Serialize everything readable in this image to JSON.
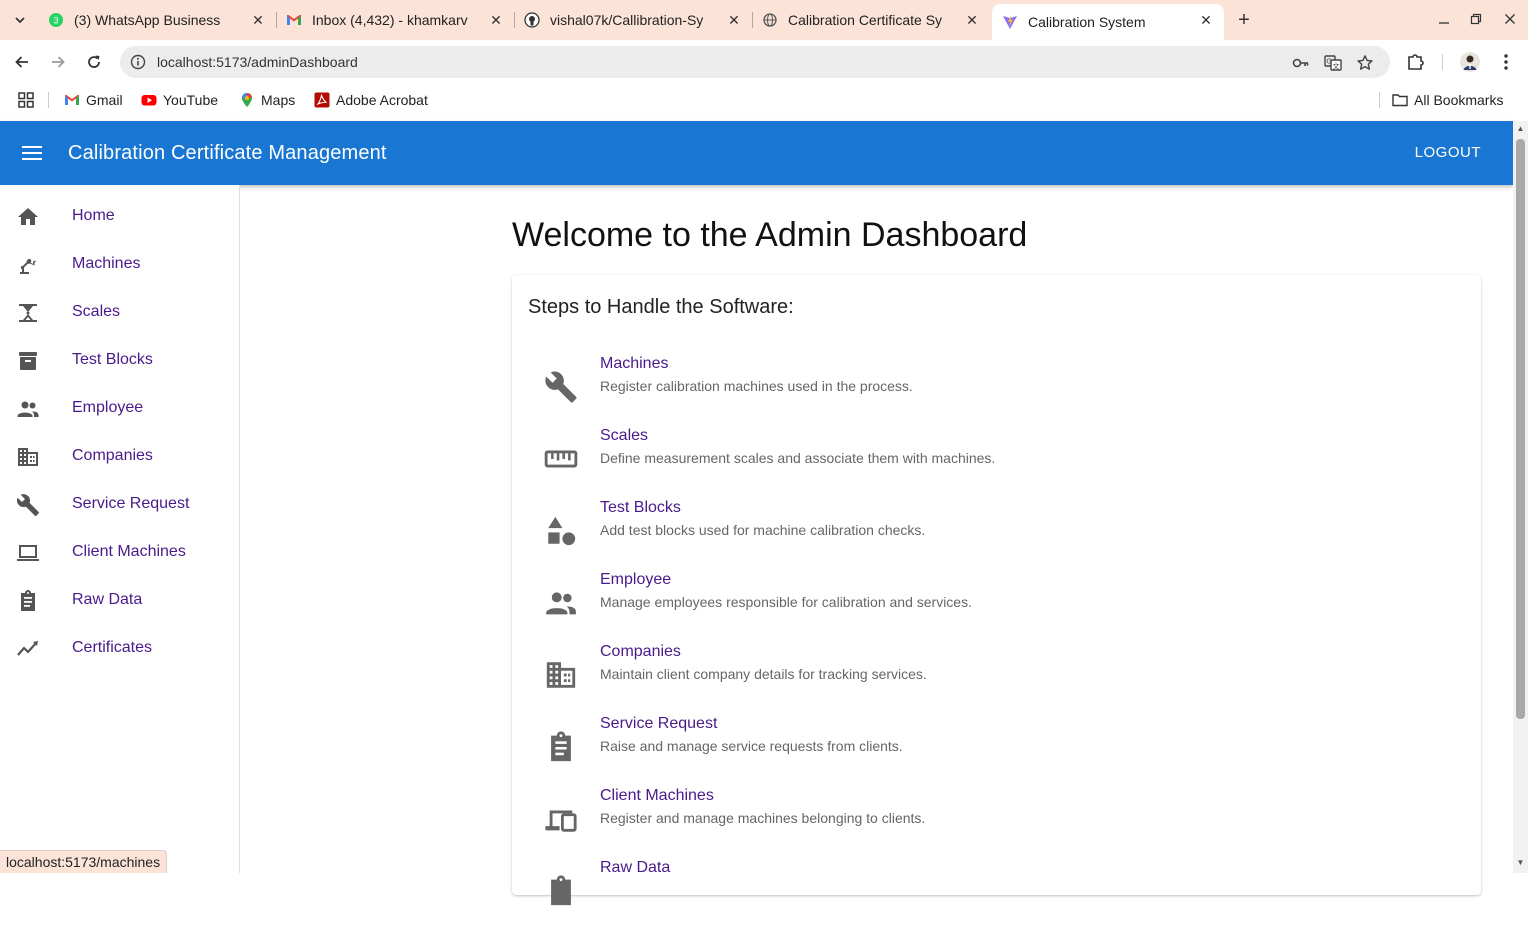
{
  "browser": {
    "tabs": [
      {
        "title": "(3) WhatsApp Business",
        "icon": "whatsapp-icon",
        "active": false
      },
      {
        "title": "Inbox (4,432) - khamkarv",
        "icon": "gmail-icon",
        "active": false
      },
      {
        "title": "vishal07k/Callibration-Sy",
        "icon": "github-icon",
        "active": false
      },
      {
        "title": "Calibration Certificate Sy",
        "icon": "globe-icon",
        "active": false
      },
      {
        "title": "Calibration System",
        "icon": "vite-icon",
        "active": true
      }
    ],
    "url": "localhost:5173/adminDashboard",
    "bookmarks": [
      "Gmail",
      "YouTube",
      "Maps",
      "Adobe Acrobat"
    ],
    "all_bookmarks": "All Bookmarks",
    "status_url": "localhost:5173/machines"
  },
  "header": {
    "title": "Calibration Certificate Management",
    "logout": "LOGOUT",
    "color": "#1976d2"
  },
  "sidebar": {
    "items": [
      {
        "label": "Home",
        "icon": "home-icon"
      },
      {
        "label": "Machines",
        "icon": "precision-manufacturing-icon"
      },
      {
        "label": "Scales",
        "icon": "scale-icon"
      },
      {
        "label": "Test Blocks",
        "icon": "archive-box-icon"
      },
      {
        "label": "Employee",
        "icon": "people-icon"
      },
      {
        "label": "Companies",
        "icon": "building-icon"
      },
      {
        "label": "Service Request",
        "icon": "wrench-icon"
      },
      {
        "label": "Client Machines",
        "icon": "laptop-icon"
      },
      {
        "label": "Raw Data",
        "icon": "clipboard-icon"
      },
      {
        "label": "Certificates",
        "icon": "trend-line-icon"
      }
    ]
  },
  "main": {
    "title": "Welcome to the Admin Dashboard",
    "card_title": "Steps to Handle the Software:",
    "steps": [
      {
        "name": "Machines",
        "desc": "Register calibration machines used in the process.",
        "icon": "wrench-icon"
      },
      {
        "name": "Scales",
        "desc": "Define measurement scales and associate them with machines.",
        "icon": "ruler-icon"
      },
      {
        "name": "Test Blocks",
        "desc": "Add test blocks used for machine calibration checks.",
        "icon": "shapes-icon"
      },
      {
        "name": "Employee",
        "desc": "Manage employees responsible for calibration and services.",
        "icon": "people-icon"
      },
      {
        "name": "Companies",
        "desc": "Maintain client company details for tracking services.",
        "icon": "building-icon"
      },
      {
        "name": "Service Request",
        "desc": "Raise and manage service requests from clients.",
        "icon": "clipboard-icon"
      },
      {
        "name": "Client Machines",
        "desc": "Register and manage machines belonging to clients.",
        "icon": "devices-icon"
      },
      {
        "name": "Raw Data",
        "desc": "",
        "icon": "clipboard-icon"
      }
    ]
  }
}
